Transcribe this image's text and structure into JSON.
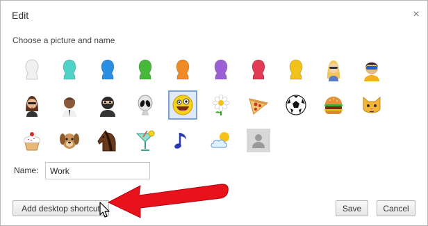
{
  "dialog": {
    "title": "Edit",
    "close_glyph": "×",
    "subtitle": "Choose a picture and name"
  },
  "avatars": [
    {
      "name": "avatar-silhouette-white",
      "kind": "silhouette",
      "color": "#f0f0f0"
    },
    {
      "name": "avatar-silhouette-teal",
      "kind": "silhouette",
      "color": "#4fd3c9"
    },
    {
      "name": "avatar-silhouette-blue",
      "kind": "silhouette",
      "color": "#2a8fe0"
    },
    {
      "name": "avatar-silhouette-green",
      "kind": "silhouette",
      "color": "#47b83a"
    },
    {
      "name": "avatar-silhouette-orange",
      "kind": "silhouette",
      "color": "#f08a24"
    },
    {
      "name": "avatar-silhouette-purple",
      "kind": "silhouette",
      "color": "#9b5fd6"
    },
    {
      "name": "avatar-silhouette-red",
      "kind": "silhouette",
      "color": "#e03a55"
    },
    {
      "name": "avatar-silhouette-yellow",
      "kind": "silhouette",
      "color": "#f2c21a"
    },
    {
      "name": "avatar-blonde-woman",
      "kind": "blonde"
    },
    {
      "name": "avatar-superhero",
      "kind": "hero"
    },
    {
      "name": "avatar-businesswoman",
      "kind": "woman"
    },
    {
      "name": "avatar-businessman",
      "kind": "man"
    },
    {
      "name": "avatar-ninja",
      "kind": "ninja"
    },
    {
      "name": "avatar-alien",
      "kind": "alien"
    },
    {
      "name": "avatar-smiley",
      "kind": "smiley",
      "selected": true
    },
    {
      "name": "avatar-flower",
      "kind": "flower"
    },
    {
      "name": "avatar-pizza",
      "kind": "pizza"
    },
    {
      "name": "avatar-soccer-ball",
      "kind": "ball"
    },
    {
      "name": "avatar-burger",
      "kind": "burger"
    },
    {
      "name": "avatar-cat",
      "kind": "cat"
    },
    {
      "name": "avatar-cupcake",
      "kind": "cupcake"
    },
    {
      "name": "avatar-dog",
      "kind": "dog"
    },
    {
      "name": "avatar-horse",
      "kind": "horse"
    },
    {
      "name": "avatar-cocktail",
      "kind": "cocktail"
    },
    {
      "name": "avatar-music-note",
      "kind": "note"
    },
    {
      "name": "avatar-weather",
      "kind": "weather"
    },
    {
      "name": "avatar-placeholder",
      "kind": "placeholder"
    }
  ],
  "name_field": {
    "label": "Name:",
    "value": "Work"
  },
  "buttons": {
    "add_shortcut": "Add desktop shortcut",
    "save": "Save",
    "cancel": "Cancel"
  },
  "annotation": {
    "arrow_color": "#e8121b"
  }
}
